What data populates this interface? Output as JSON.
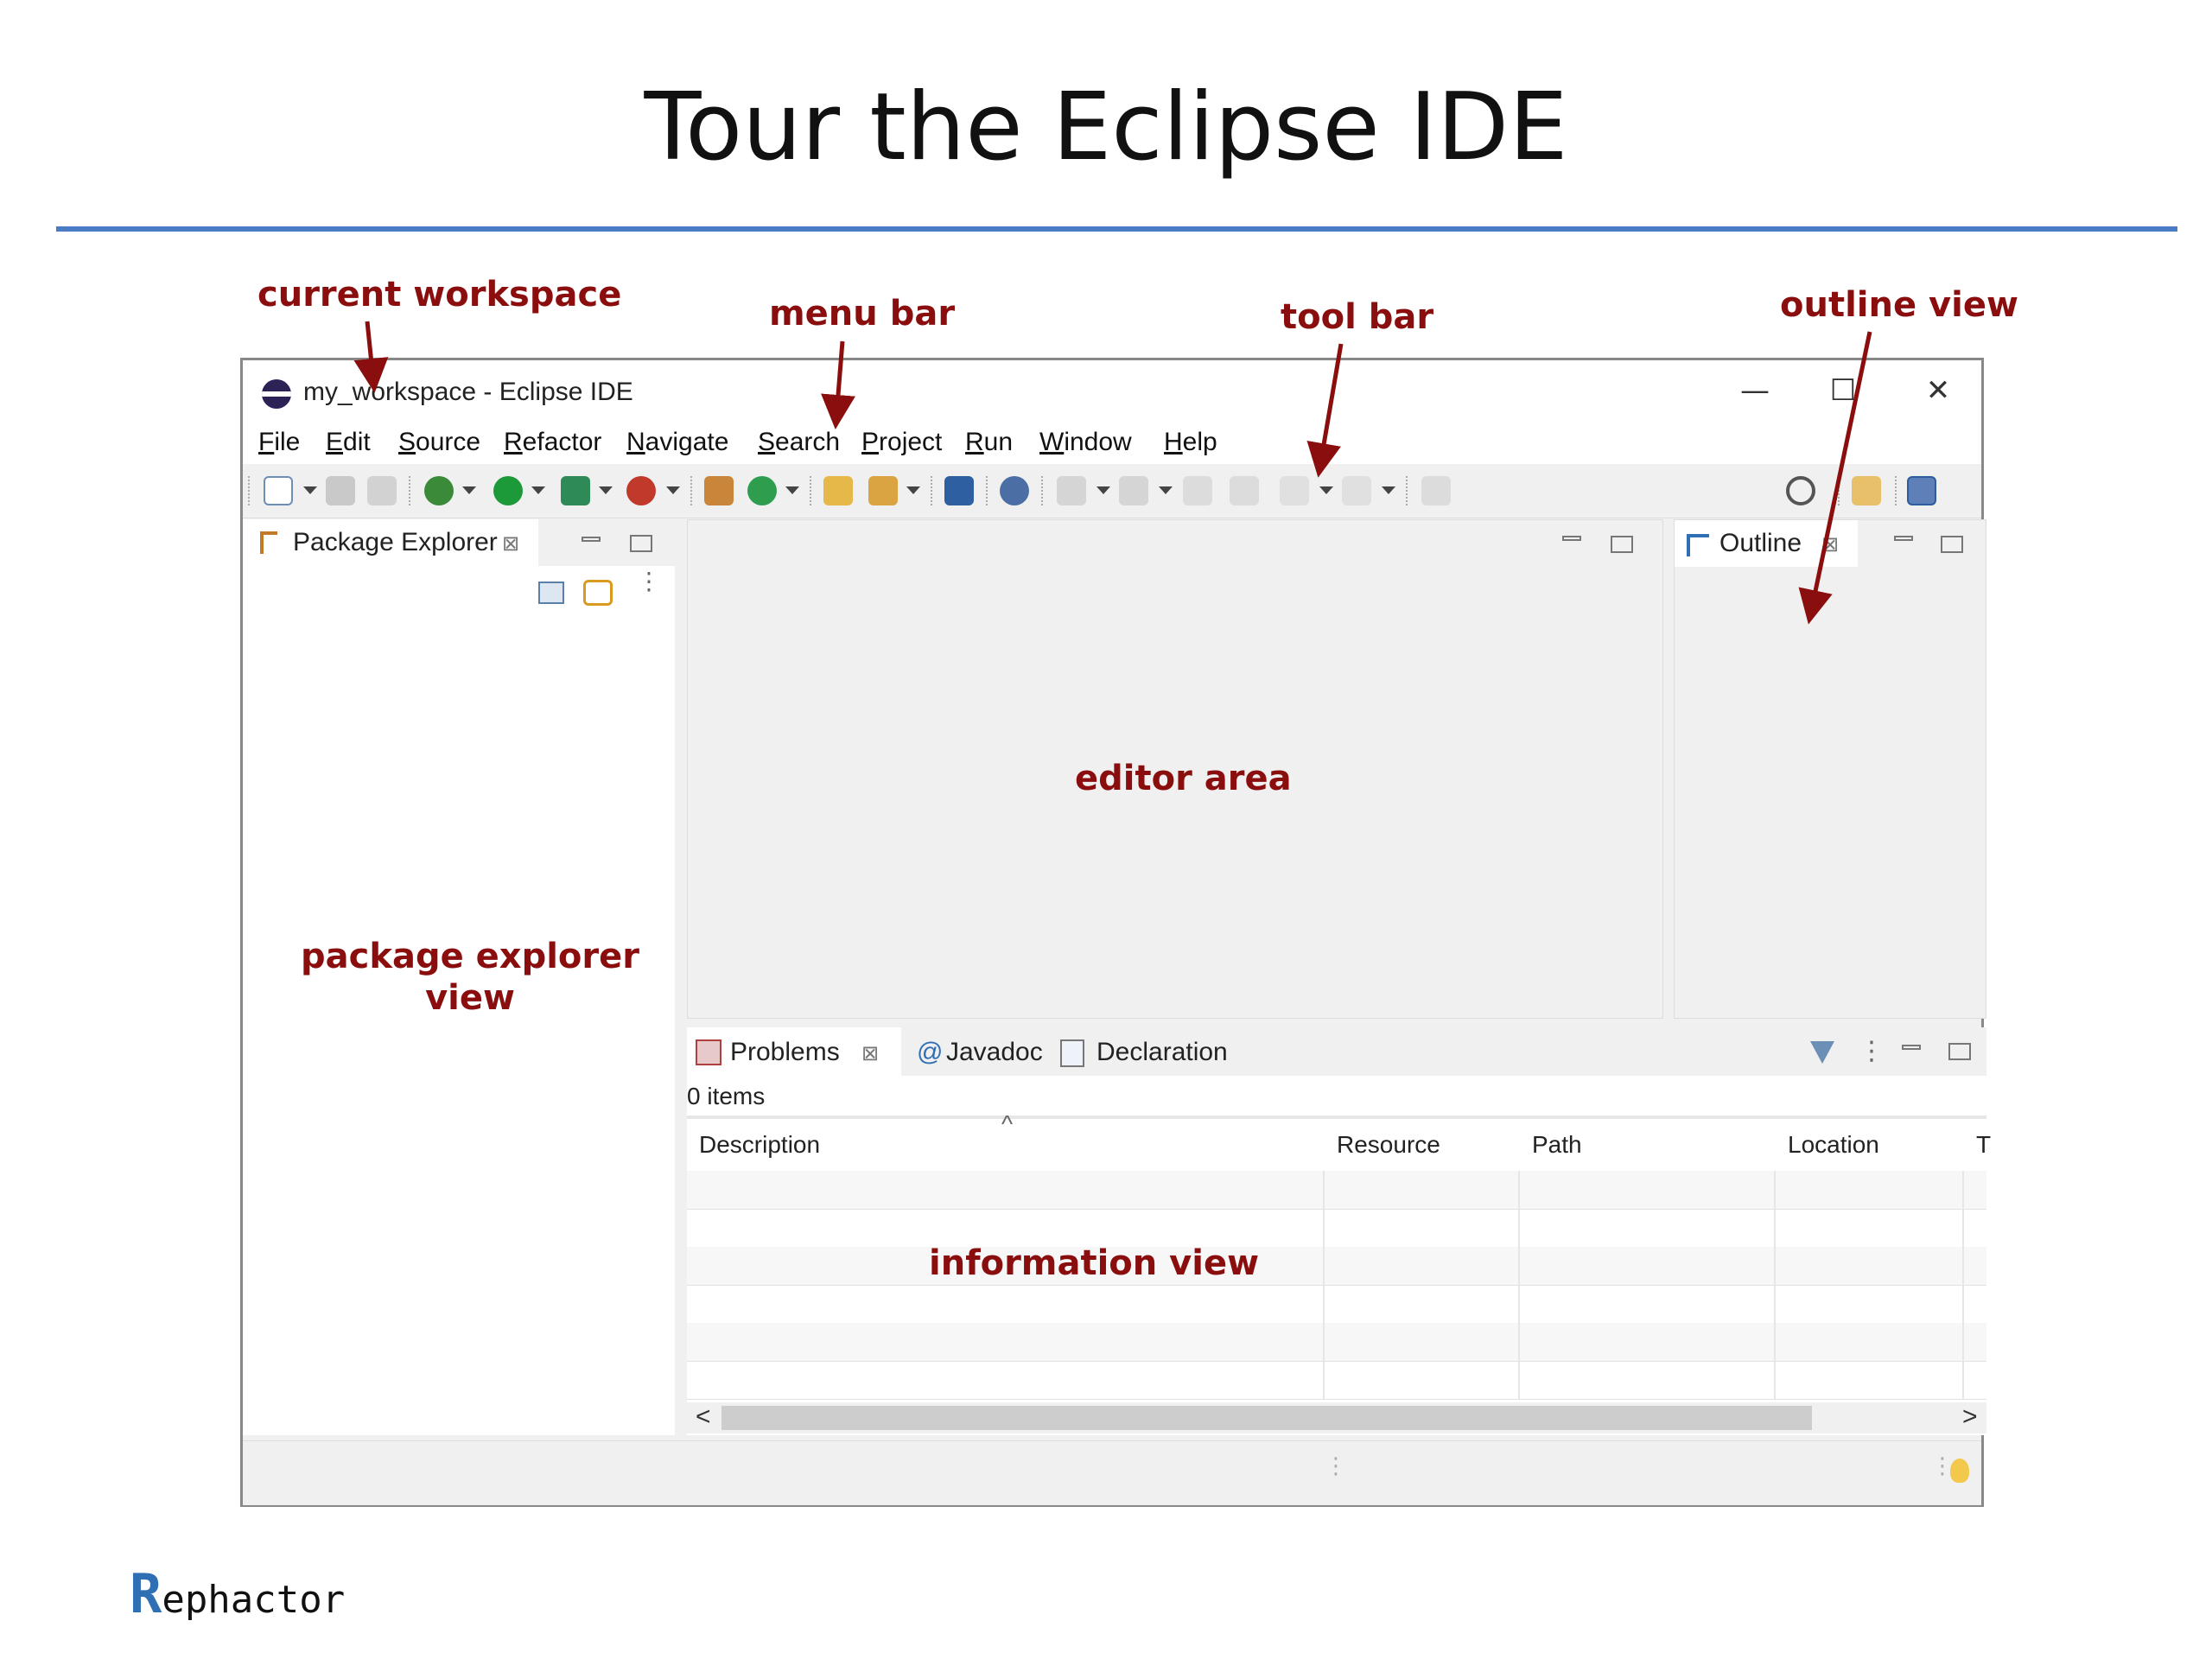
{
  "slide": {
    "title": "Tour the Eclipse IDE",
    "callouts": {
      "current_workspace": "current workspace",
      "menu_bar": "menu bar",
      "tool_bar": "tool bar",
      "outline_view": "outline view",
      "editor_area": "editor area",
      "package_explorer_view": [
        "package explorer",
        "view"
      ],
      "information_view": "information view"
    },
    "brand": {
      "initial": "R",
      "rest": "ephactor"
    }
  },
  "window": {
    "title": "my_workspace - Eclipse IDE",
    "controls": {
      "minimize": "—",
      "maximize": "☐",
      "close": "✕"
    },
    "menu": [
      "File",
      "Edit",
      "Source",
      "Refactor",
      "Navigate",
      "Search",
      "Project",
      "Run",
      "Window",
      "Help"
    ]
  },
  "package_explorer": {
    "tab_label": "Package Explorer",
    "close": "⊠"
  },
  "outline": {
    "tab_label": "Outline",
    "close": "⊠"
  },
  "info_panel": {
    "tabs": [
      {
        "label": "Problems",
        "close": "⊠"
      },
      {
        "label": "Javadoc",
        "icon_glyph": "@"
      },
      {
        "label": "Declaration"
      }
    ],
    "item_count": "0 items",
    "columns": [
      "Description",
      "Resource",
      "Path",
      "Location",
      "T"
    ],
    "sort_glyph": "^",
    "scroll_left": "<",
    "scroll_right": ">"
  },
  "colors": {
    "callout": "#8b0e0e",
    "rule": "#4a7cc4",
    "brand_blue": "#2f6fb3"
  }
}
